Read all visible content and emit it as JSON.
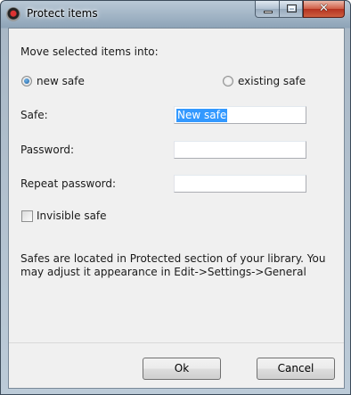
{
  "window": {
    "title": "Protect items"
  },
  "form": {
    "heading": "Move selected items into:",
    "radio_new_label": "new safe",
    "radio_existing_label": "existing safe",
    "selected_option": "new safe",
    "safe_label": "Safe:",
    "safe_value": "New safe",
    "password_label": "Password:",
    "password_value": "",
    "repeat_label": "Repeat password:",
    "repeat_value": "",
    "invisible_label": "Invisible safe",
    "invisible_checked": false,
    "info_line1": "Safes are located in Protected section of your library. You",
    "info_line2": "may adjust it appearance in Edit->Settings->General"
  },
  "buttons": {
    "ok_label": "Ok",
    "cancel_label": "Cancel"
  }
}
